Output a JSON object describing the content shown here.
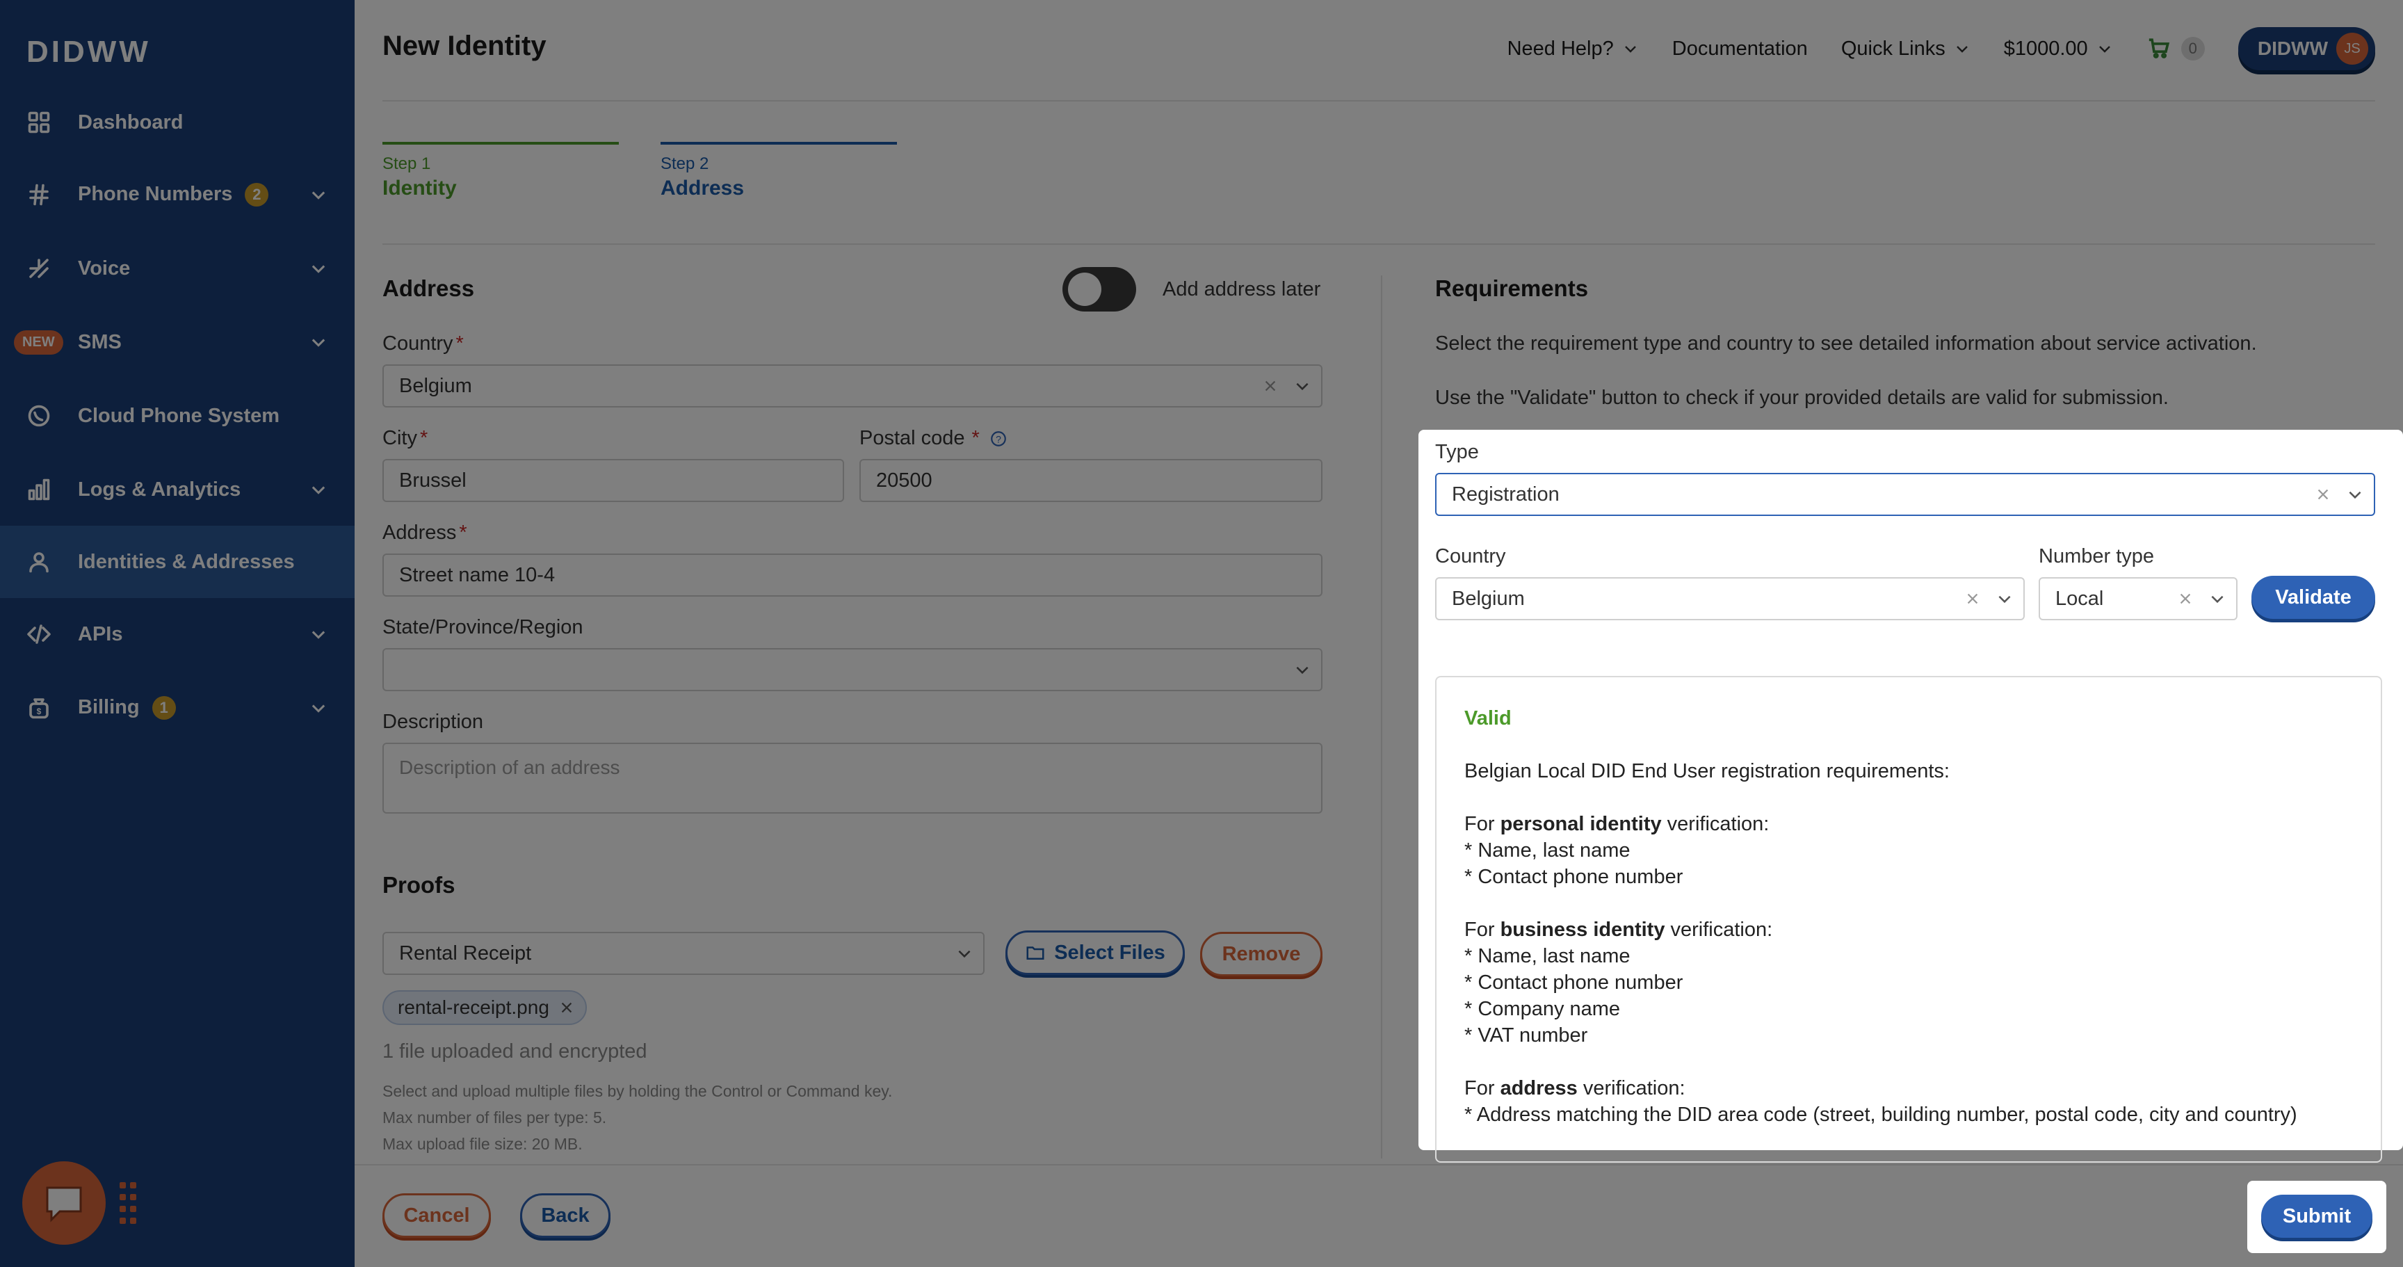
{
  "brand": {
    "logo": "DIDWW"
  },
  "sidebar": {
    "items": [
      {
        "label": "Dashboard",
        "icon": "grid-icon"
      },
      {
        "label": "Phone Numbers",
        "icon": "hash-icon",
        "badge": "2"
      },
      {
        "label": "Voice",
        "icon": "phone-arrow-icon"
      },
      {
        "label": "SMS",
        "icon": "none",
        "new_badge": "NEW"
      },
      {
        "label": "Cloud Phone System",
        "icon": "clock-phone-icon"
      },
      {
        "label": "Logs & Analytics",
        "icon": "bar-chart-icon"
      },
      {
        "label": "Identities & Addresses",
        "icon": "user-icon"
      },
      {
        "label": "APIs",
        "icon": "code-icon"
      },
      {
        "label": "Billing",
        "icon": "money-bag-icon",
        "badge": "1"
      }
    ]
  },
  "header": {
    "title": "New Identity",
    "need_help": "Need Help?",
    "documentation": "Documentation",
    "quick_links": "Quick Links",
    "balance": "$1000.00",
    "cart_count": "0",
    "account_label": "DIDWW",
    "avatar_initials": "JS"
  },
  "steps": [
    {
      "number": "Step 1",
      "name": "Identity",
      "color": "#4c9a2a"
    },
    {
      "number": "Step 2",
      "name": "Address",
      "color": "#1b5aa8"
    }
  ],
  "address": {
    "title": "Address",
    "toggle_label": "Add address later",
    "country_label": "Country",
    "country_value": "Belgium",
    "city_label": "City",
    "city_value": "Brussel",
    "postal_label": "Postal code",
    "postal_value": "20500",
    "address_label": "Address",
    "address_value": "Street name 10-4",
    "region_label": "State/Province/Region",
    "region_value": "",
    "description_label": "Description",
    "description_placeholder": "Description of an address"
  },
  "proofs": {
    "title": "Proofs",
    "proof_type": "Rental Receipt",
    "select_files": "Select Files",
    "remove": "Remove",
    "file_name": "rental-receipt.png",
    "upload_status": "1 file uploaded and encrypted",
    "hint_1": "Select and upload multiple files by holding the Control or Command key.",
    "hint_2": "Max number of files per type: 5.",
    "hint_3": "Max upload file size: 20 MB."
  },
  "requirements": {
    "title": "Requirements",
    "intro_1": "Select the requirement type and country to see detailed information about service activation.",
    "intro_2": "Use the \"Validate\" button to check if your provided details are valid for submission.",
    "type_label": "Type",
    "type_value": "Registration",
    "country_label": "Country",
    "country_value": "Belgium",
    "number_type_label": "Number type",
    "number_type_value": "Local",
    "validate": "Validate",
    "result": {
      "status": "Valid",
      "heading": "Belgian Local DID End User registration requirements:",
      "personal_prefix": "For ",
      "personal_bold": "personal identity",
      "personal_suffix": " verification:",
      "personal_items": [
        "* Name, last name",
        "* Contact phone number"
      ],
      "business_prefix": "For ",
      "business_bold": "business identity",
      "business_suffix": " verification:",
      "business_items": [
        "* Name, last name",
        "* Contact phone number",
        "* Company name",
        "* VAT number"
      ],
      "address_prefix": "For ",
      "address_bold": "address",
      "address_suffix": " verification:",
      "address_items": [
        "* Address matching the DID area code (street, building number, postal code, city and country)"
      ]
    }
  },
  "footer": {
    "cancel": "Cancel",
    "back": "Back",
    "submit": "Submit"
  },
  "colors": {
    "sidebar": "#1b3f78",
    "accent": "#2e62b5",
    "danger": "#d9663a",
    "success": "#4c9a2a"
  }
}
